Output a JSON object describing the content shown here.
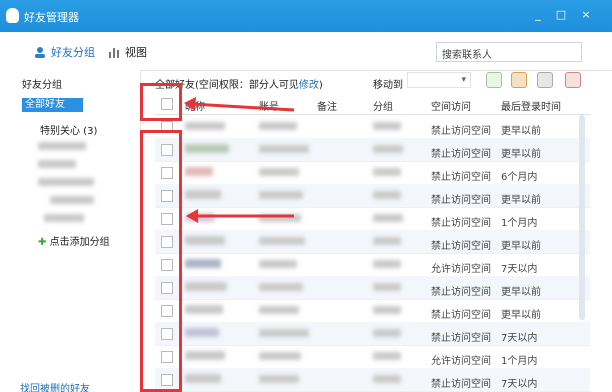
{
  "window": {
    "title": "好友管理器",
    "min_glyph": "_",
    "max_glyph": "□",
    "close_glyph": "×"
  },
  "toolbar": {
    "tab_groups": "好友分组",
    "tab_view": "视图",
    "search_placeholder": "搜索联系人"
  },
  "sidebar": {
    "heading": "好友分组",
    "selected": "全部好友",
    "special": "特别关心 (3)",
    "add_group": "点击添加分组",
    "footer_link": "找回被删的好友"
  },
  "main": {
    "header_prefix": "全部好友(空间权限：部分人可见",
    "header_link": "修改",
    "header_suffix": ")",
    "move_to": "移动到",
    "move_arrow": "▾",
    "columns": [
      "昵称",
      "账号",
      "备注",
      "分组",
      "空间访问",
      "最后登录时间"
    ]
  },
  "rows": [
    {
      "access": "禁止访问空间",
      "last": "更早以前"
    },
    {
      "access": "禁止访问空间",
      "last": "更早以前"
    },
    {
      "access": "禁止访问空间",
      "last": "6个月内"
    },
    {
      "access": "禁止访问空间",
      "last": "更早以前"
    },
    {
      "access": "禁止访问空间",
      "last": "1个月内"
    },
    {
      "access": "禁止访问空间",
      "last": "更早以前"
    },
    {
      "access": "允许访问空间",
      "last": "7天以内"
    },
    {
      "access": "禁止访问空间",
      "last": "更早以前"
    },
    {
      "access": "禁止访问空间",
      "last": "更早以前"
    },
    {
      "access": "禁止访问空间",
      "last": "7天以内"
    },
    {
      "access": "允许访问空间",
      "last": "1个月内"
    },
    {
      "access": "禁止访问空间",
      "last": "7天以内"
    }
  ],
  "colors": {
    "titlebar": "#1e8fdc",
    "selection": "#2b90e0",
    "annotation_red": "#e3353a",
    "link": "#1a6fc1"
  },
  "icons": [
    "qq-penguin-icon",
    "users-icon",
    "chart-icon",
    "add-user-icon",
    "user-group-icon",
    "remove-user-icon",
    "plus-icon"
  ]
}
